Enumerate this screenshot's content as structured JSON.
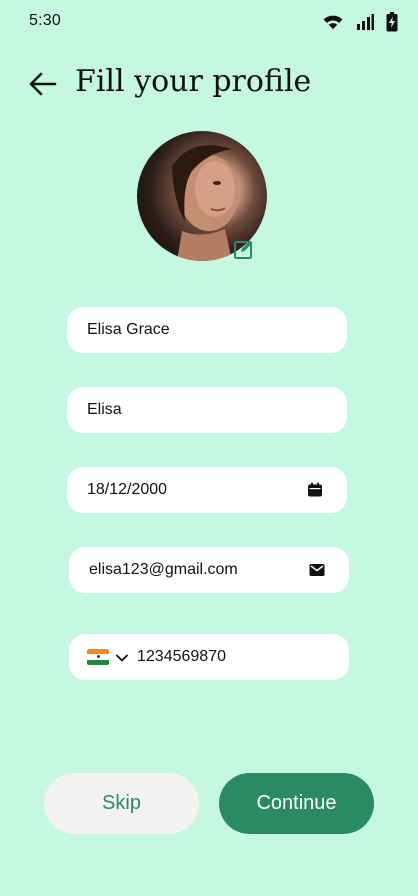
{
  "status": {
    "time": "5:30"
  },
  "header": {
    "title": "Fill your profile"
  },
  "profile": {
    "full_name": "Elisa Grace",
    "nickname": "Elisa",
    "dob": "18/12/2000",
    "email": "elisa123@gmail.com",
    "phone": "1234569870",
    "country_flag": "india-flag-icon"
  },
  "actions": {
    "skip": "Skip",
    "continue": "Continue"
  },
  "colors": {
    "background": "#c6f8e1",
    "accent": "#2a8a64",
    "field": "#ffffff",
    "skip_bg": "#f3f3f3"
  }
}
